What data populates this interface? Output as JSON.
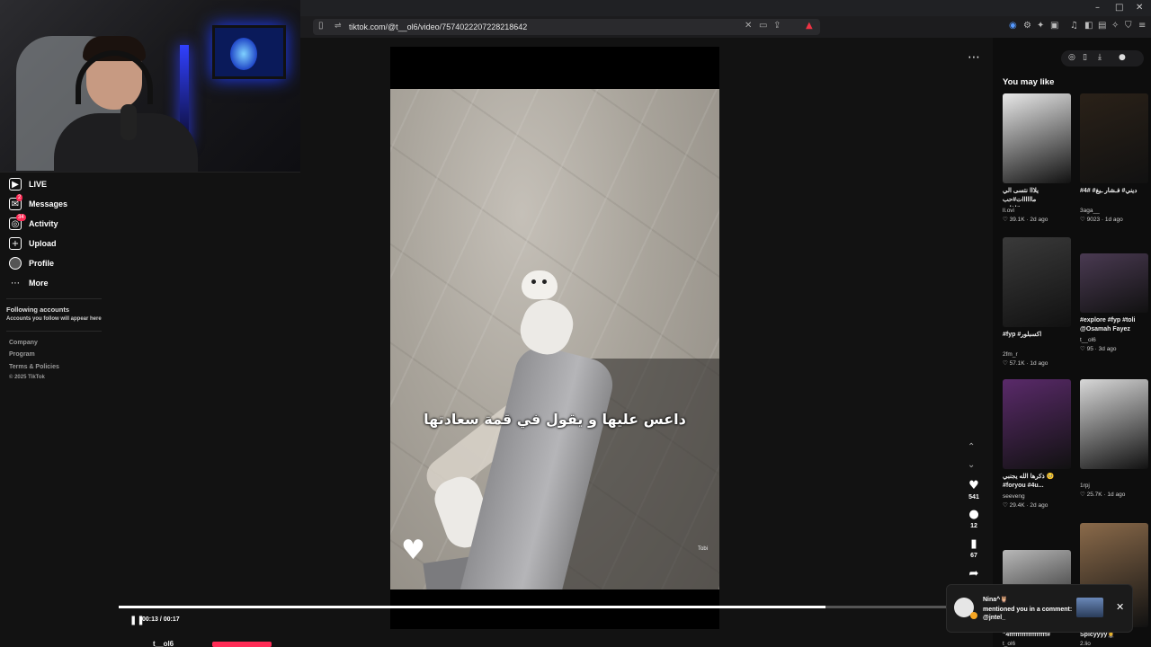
{
  "browser": {
    "url": "tiktok.com/@t__ol6/video/7574022207228218642",
    "window_controls": [
      "–",
      "□",
      "✕"
    ]
  },
  "sidebar": {
    "items": [
      {
        "label": "LIVE",
        "icon": "live-icon",
        "badge": ""
      },
      {
        "label": "Messages",
        "icon": "messages-icon",
        "badge": "2"
      },
      {
        "label": "Activity",
        "icon": "activity-icon",
        "badge": "34"
      },
      {
        "label": "Upload",
        "icon": "upload-icon",
        "badge": ""
      },
      {
        "label": "Profile",
        "icon": "profile-icon",
        "badge": ""
      },
      {
        "label": "More",
        "icon": "more-icon",
        "badge": ""
      }
    ],
    "following_title": "Following accounts",
    "following_sub": "Accounts you follow will appear here",
    "footer": [
      "Company",
      "Program",
      "Terms & Policies",
      "© 2025 TikTok"
    ]
  },
  "video": {
    "caption": "داعس عليها و يقول في قمة سعادتها",
    "watermark": "Tobi",
    "time": "00:13 / 00:17",
    "progress": 0.809,
    "author": "t__ol6"
  },
  "actions": {
    "likes": "541",
    "comments": "12",
    "saves": "67"
  },
  "right_panel": {
    "title": "You may like",
    "cards": [
      {
        "caption": "يلااا نتسى الي ماااااات#حب\n__#اغاني",
        "user": "ll.ovi",
        "likes": "39.1K",
        "age": "2d ago",
        "thumb": "#e8e8e8"
      },
      {
        "caption": "#4# #ديني# فـشار ـيغ",
        "user": "3aga__",
        "likes": "9023",
        "age": "1d ago",
        "thumb": "#2a2118"
      },
      {
        "caption": "#fyp #اكسبلور",
        "user": "2fm_r",
        "likes": "57.1K",
        "age": "1d ago",
        "thumb": "#3a3a3a"
      },
      {
        "caption": "#explore #fyp #toli\n@Osamah Fayez",
        "user": "t__ol6",
        "likes": "95",
        "age": "3d ago",
        "thumb": "#4a3a52"
      },
      {
        "caption": "ذكرها الله يجنبي 🥺\n#foryou #4u...",
        "user": "seeveng",
        "likes": "29.4K",
        "age": "2d ago",
        "thumb": "#5a2a6a"
      },
      {
        "caption": "",
        "user": "1rpj",
        "likes": "25.7K",
        "age": "1d ago",
        "thumb": "#d8d8d8"
      },
      {
        "caption": "\"4ffffffffffffffffff#",
        "user": "t_ol6",
        "likes": "",
        "age": "",
        "thumb": "#b8b8b8"
      },
      {
        "caption": "Spicyyyy🤵‍♀️",
        "user": "2.lio",
        "likes": "",
        "age": "",
        "thumb": "#8a6a4a"
      }
    ]
  },
  "toast": {
    "who": "Nina^🦉",
    "message": "mentioned you in a comment: @jntel_"
  }
}
